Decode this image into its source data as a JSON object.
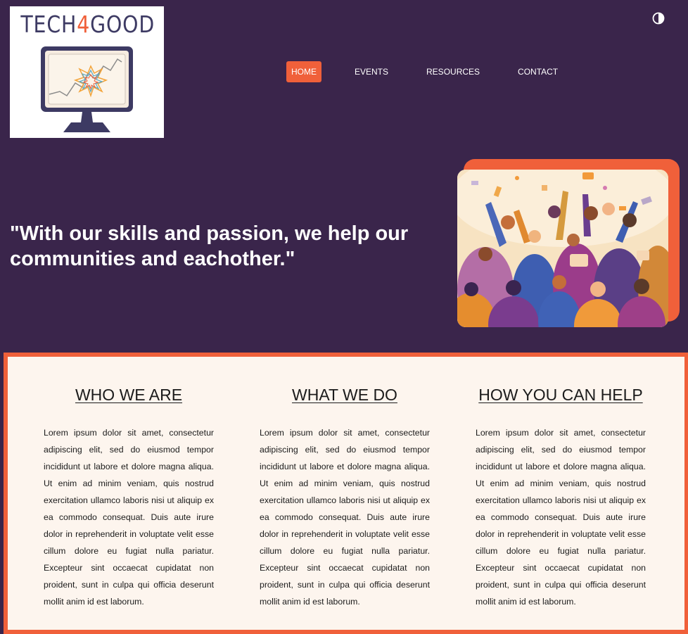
{
  "brand": {
    "logo_prefix": "TECH",
    "logo_number": "4",
    "logo_suffix": "GOOD",
    "accent_color": "#f0603a",
    "background_color": "#3a254b"
  },
  "header": {
    "theme_toggle_icon": "contrast-icon",
    "nav": [
      {
        "label": "HOME",
        "active": true
      },
      {
        "label": "EVENTS",
        "active": false
      },
      {
        "label": "RESOURCES",
        "active": false
      },
      {
        "label": "CONTACT",
        "active": false
      }
    ]
  },
  "hero": {
    "quote": "\"With our skills and passion, we help our communities and eachother.\""
  },
  "sections": [
    {
      "title": "WHO WE ARE",
      "body": "Lorem ipsum dolor sit amet, consectetur adipiscing elit, sed do eiusmod tempor incididunt ut labore et dolore magna aliqua. Ut enim ad minim veniam, quis nostrud exercitation ullamco laboris nisi ut aliquip ex ea commodo consequat. Duis aute irure dolor in reprehenderit in voluptate velit esse cillum dolore eu fugiat nulla pariatur. Excepteur sint occaecat cupidatat non proident, sunt in culpa qui officia deserunt mollit anim id est laborum."
    },
    {
      "title": "WHAT WE DO",
      "body": "Lorem ipsum dolor sit amet, consectetur adipiscing elit, sed do eiusmod tempor incididunt ut labore et dolore magna aliqua. Ut enim ad minim veniam, quis nostrud exercitation ullamco laboris nisi ut aliquip ex ea commodo consequat. Duis aute irure dolor in reprehenderit in voluptate velit esse cillum dolore eu fugiat nulla pariatur. Excepteur sint occaecat cupidatat non proident, sunt in culpa qui officia deserunt mollit anim id est laborum."
    },
    {
      "title": "HOW YOU CAN HELP",
      "body": "Lorem ipsum dolor sit amet, consectetur adipiscing elit, sed do eiusmod tempor incididunt ut labore et dolore magna aliqua. Ut enim ad minim veniam, quis nostrud exercitation ullamco laboris nisi ut aliquip ex ea commodo consequat. Duis aute irure dolor in reprehenderit in voluptate velit esse cillum dolore eu fugiat nulla pariatur. Excepteur sint occaecat cupidatat non proident, sunt in culpa qui officia deserunt mollit anim id est laborum."
    }
  ]
}
